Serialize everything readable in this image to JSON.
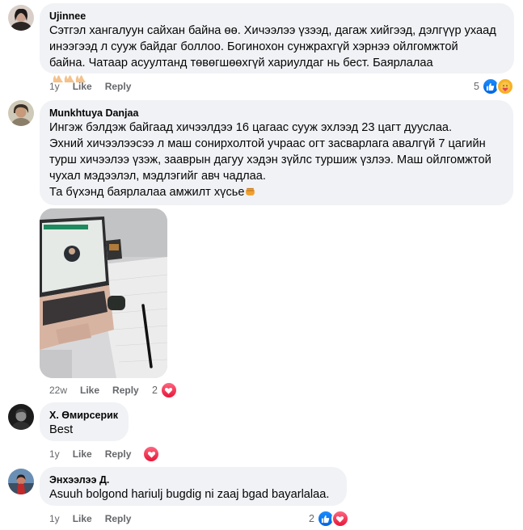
{
  "comments": [
    {
      "author": "Ujinnee",
      "text": "Сэтгэл хангалуун сайхан байна өө. Хичээлээ үзээд, дагаж хийгээд, дэлгүүр ухаад\nинээгээд л сууж байдаг боллоо. Богинохон сунжрахгүй хэрнээ ойлгомжтой\nбайна. Чатаар асуултанд төвөгшөөхгүй хариулдаг нь бест. Баярлалаа",
      "time": "1y",
      "like": "Like",
      "reply": "Reply",
      "reaction_count": "5",
      "reactions": [
        "like-icon",
        "care-icon"
      ]
    },
    {
      "author": "Munkhtuya Danjaa",
      "text": "Ингэж бэлдэж байгаад хичээлдээ 16 цагаас сууж эхлээд 23 цагт дууслаа.\nЭхний хичээлээсээ л маш сонирхолтой учраас огт засварлага авалгүй 7 цагийн\nтурш хичээлээ үзэж, зааврын дагуу хэдэн зүйлс туршиж үзлээ. Маш ойлгомжтой\nчухал мэдээлэл, мэдлэгийг авч чадлаа.\nТа бүхэнд баярлалаа амжилт хүсье",
      "time": "22w",
      "like": "Like",
      "reply": "Reply",
      "reaction_count": "2",
      "reactions": [
        "love-icon"
      ]
    },
    {
      "author": "Х. Өмирсерик",
      "text": "Best",
      "time": "1y",
      "like": "Like",
      "reply": "Reply",
      "reaction_count": "",
      "reactions": [
        "love-icon"
      ]
    },
    {
      "author": "Энхээлээ Д.",
      "text": "Asuuh bolgond hariulj bugdig ni zaaj bgad bayarlalaa.",
      "time": "1y",
      "like": "Like",
      "reply": "Reply",
      "reaction_count": "2",
      "reactions": [
        "like-icon",
        "love-icon"
      ]
    }
  ],
  "colors": {
    "bubble": "#f0f2f5",
    "meta": "#65676b",
    "like": "#1877f2",
    "love": "#f33e58"
  }
}
